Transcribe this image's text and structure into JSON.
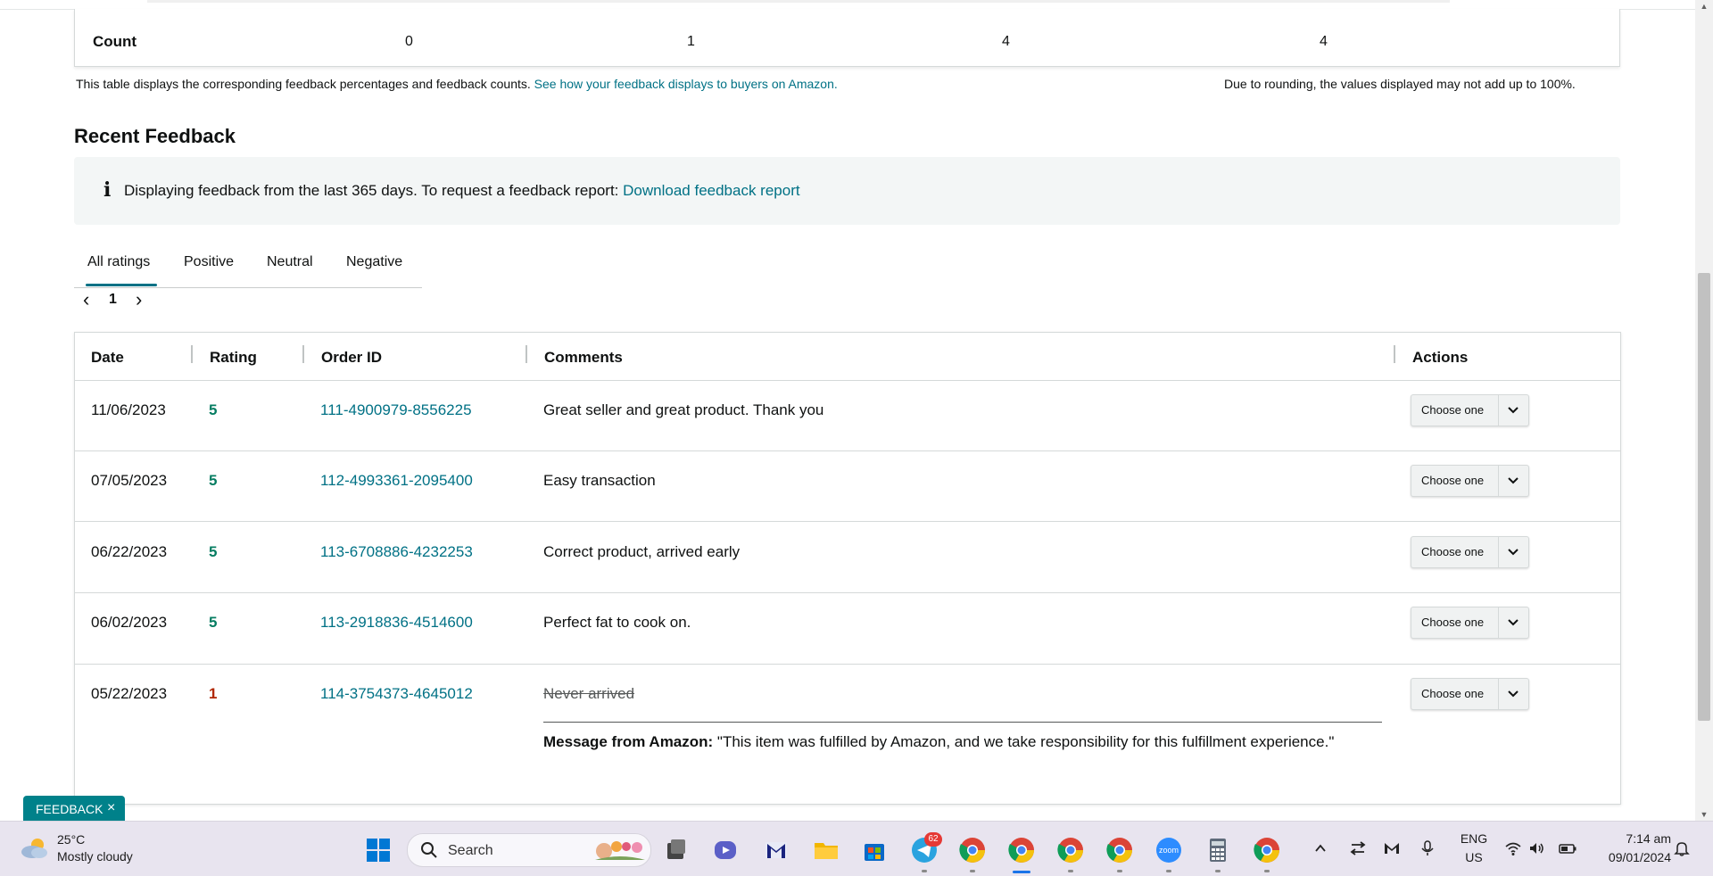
{
  "count_row": {
    "label": "Count",
    "values": [
      "0",
      "1",
      "4",
      "4"
    ]
  },
  "notes": {
    "left_text": "This table displays the corresponding feedback percentages and feedback counts.",
    "left_link": "See how your feedback displays to buyers on Amazon.",
    "right_text": "Due to rounding, the values displayed may not add up to 100%."
  },
  "recent": {
    "title": "Recent Feedback",
    "info_icon": "info-icon",
    "info_text": "Displaying feedback from the last 365 days. To request a feedback report:",
    "info_link": "Download feedback report"
  },
  "tabs": [
    {
      "label": "All ratings",
      "active": true
    },
    {
      "label": "Positive",
      "active": false
    },
    {
      "label": "Neutral",
      "active": false
    },
    {
      "label": "Negative",
      "active": false
    }
  ],
  "pager": {
    "prev": "‹",
    "page": "1",
    "next": "›"
  },
  "table": {
    "headers": {
      "date": "Date",
      "rating": "Rating",
      "order_id": "Order ID",
      "comments": "Comments",
      "actions": "Actions"
    },
    "rows": [
      {
        "date": "11/06/2023",
        "rating": "5",
        "order_id": "111-4900979-8556225",
        "comment": "Great seller and great product. Thank you",
        "action": "Choose one"
      },
      {
        "date": "07/05/2023",
        "rating": "5",
        "order_id": "112-4993361-2095400",
        "comment": "Easy transaction",
        "action": "Choose one"
      },
      {
        "date": "06/22/2023",
        "rating": "5",
        "order_id": "113-6708886-4232253",
        "comment": "Correct product, arrived early",
        "action": "Choose one"
      },
      {
        "date": "06/02/2023",
        "rating": "5",
        "order_id": "113-2918836-4514600",
        "comment": "Perfect fat to cook on.",
        "action": "Choose one"
      },
      {
        "date": "05/22/2023",
        "rating": "1",
        "order_id": "114-3754373-4645012",
        "comment": "Never arrived",
        "action": "Choose one"
      }
    ],
    "amazon_message": {
      "label": "Message from Amazon:",
      "text": "\"This item was fulfilled by Amazon, and we take responsibility for this fulfillment experience.\""
    }
  },
  "feedback_pill": {
    "label": "FEEDBACK",
    "close": "×"
  },
  "taskbar": {
    "weather": {
      "temp": "25°C",
      "condition": "Mostly cloudy",
      "icon": "partly-cloudy-icon"
    },
    "search_placeholder": "Search",
    "apps": [
      "start-icon",
      "file-explorer-icon",
      "teams-icon",
      "gmail-icon",
      "folder-icon",
      "store-icon",
      "telegram-icon",
      "chrome-icon",
      "chrome-icon",
      "chrome-icon",
      "chrome-icon",
      "zoom-icon",
      "calculator-icon",
      "chrome-icon"
    ],
    "telegram_badge": "62",
    "zoom_label": "zoom",
    "lang_top": "ENG",
    "lang_bottom": "US",
    "time": "7:14 am",
    "date": "09/01/2024"
  },
  "colors": {
    "link": "#007185",
    "rating_positive": "#067d62",
    "rating_negative": "#b12704",
    "accent_tab": "#007185",
    "feedback_pill": "#00818a"
  }
}
